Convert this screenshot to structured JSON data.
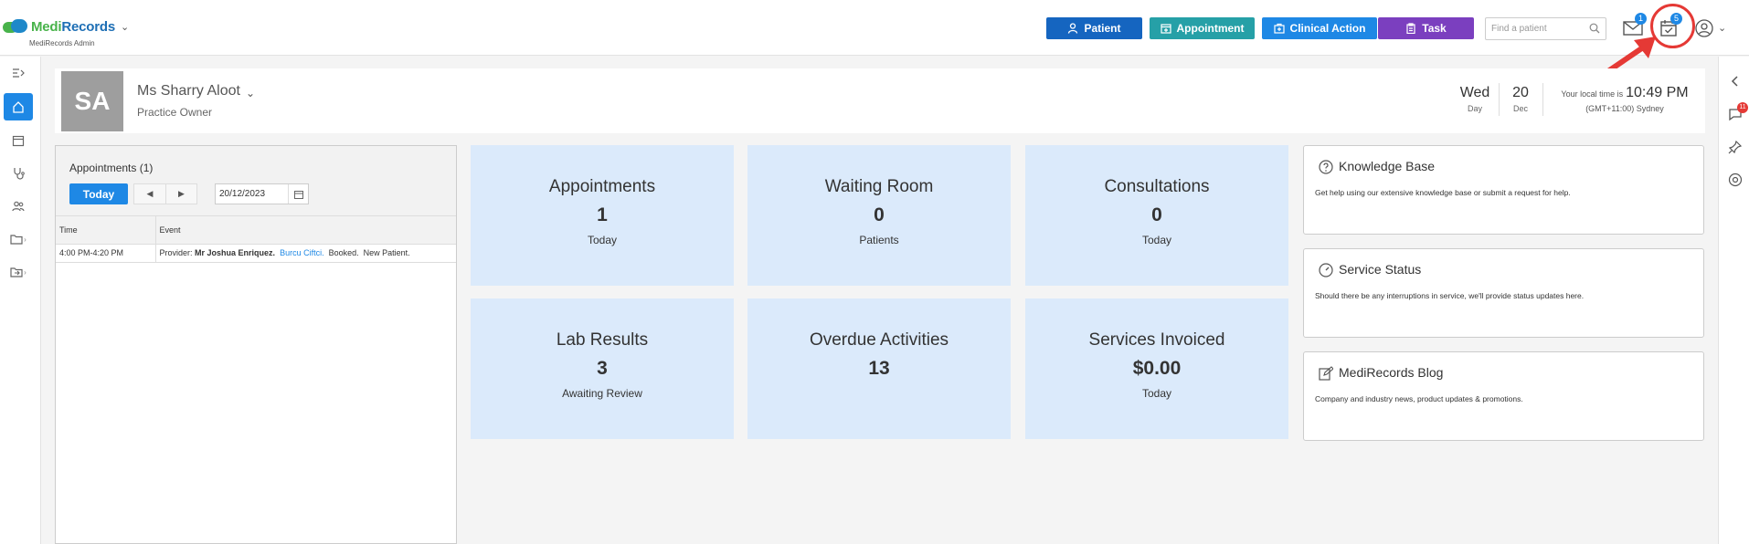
{
  "app": {
    "brand_medi": "Medi",
    "brand_records": "Records",
    "subtitle": "MediRecords Admin"
  },
  "toolbar": {
    "patient_label": "Patient",
    "appointment_label": "Appointment",
    "clinical_action_label": "Clinical Action",
    "task_label": "Task",
    "search_placeholder": "Find a patient",
    "mail_badge": "1",
    "task_badge": "5"
  },
  "right_sidebar": {
    "notification_badge": "11"
  },
  "header": {
    "initials": "SA",
    "name": "Ms Sharry Aloot",
    "role": "Practice Owner",
    "day": "Wed",
    "day_label": "Day",
    "date_num": "20",
    "month_label": "Dec",
    "time_prefix": "Your local time is",
    "time": "10:49 PM",
    "timezone": "(GMT+11:00) Sydney"
  },
  "appointments": {
    "title": "Appointments (1)",
    "today_label": "Today",
    "prev_glyph": "◀",
    "next_glyph": "▶",
    "date_value": "20/12/2023",
    "columns": [
      "Time",
      "Event"
    ],
    "rows": [
      {
        "time": "4:00 PM-4:20 PM",
        "provider_prefix": "Provider:",
        "provider": "Mr Joshua Enriquez.",
        "patient": "Burcu Ciftci.",
        "status": "Booked.",
        "note": "New Patient."
      }
    ]
  },
  "tiles": [
    {
      "title": "Appointments",
      "value": "1",
      "sub": "Today"
    },
    {
      "title": "Waiting Room",
      "value": "0",
      "sub": "Patients"
    },
    {
      "title": "Consultations",
      "value": "0",
      "sub": "Today"
    },
    {
      "title": "Lab Results",
      "value": "3",
      "sub": "Awaiting Review"
    },
    {
      "title": "Overdue Activities",
      "value": "13",
      "sub": ""
    },
    {
      "title": "Services Invoiced",
      "value": "$0.00",
      "sub": "Today"
    }
  ],
  "info_cards": [
    {
      "title": "Knowledge Base",
      "desc": "Get help using our extensive knowledge base or submit a request for help.",
      "icon": "question-circle-icon"
    },
    {
      "title": "Service Status",
      "desc": "Should there be any interruptions in service, we'll provide status updates here.",
      "icon": "gauge-icon"
    },
    {
      "title": "MediRecords Blog",
      "desc": "Company and industry news, product updates & promotions.",
      "icon": "edit-icon"
    }
  ],
  "colors": {
    "primary": "#1565c0",
    "teal": "#26a0a7",
    "blue": "#1e88e5",
    "purple": "#7b3fbf",
    "tile_bg": "#dbeafb",
    "highlight": "#e53935"
  }
}
